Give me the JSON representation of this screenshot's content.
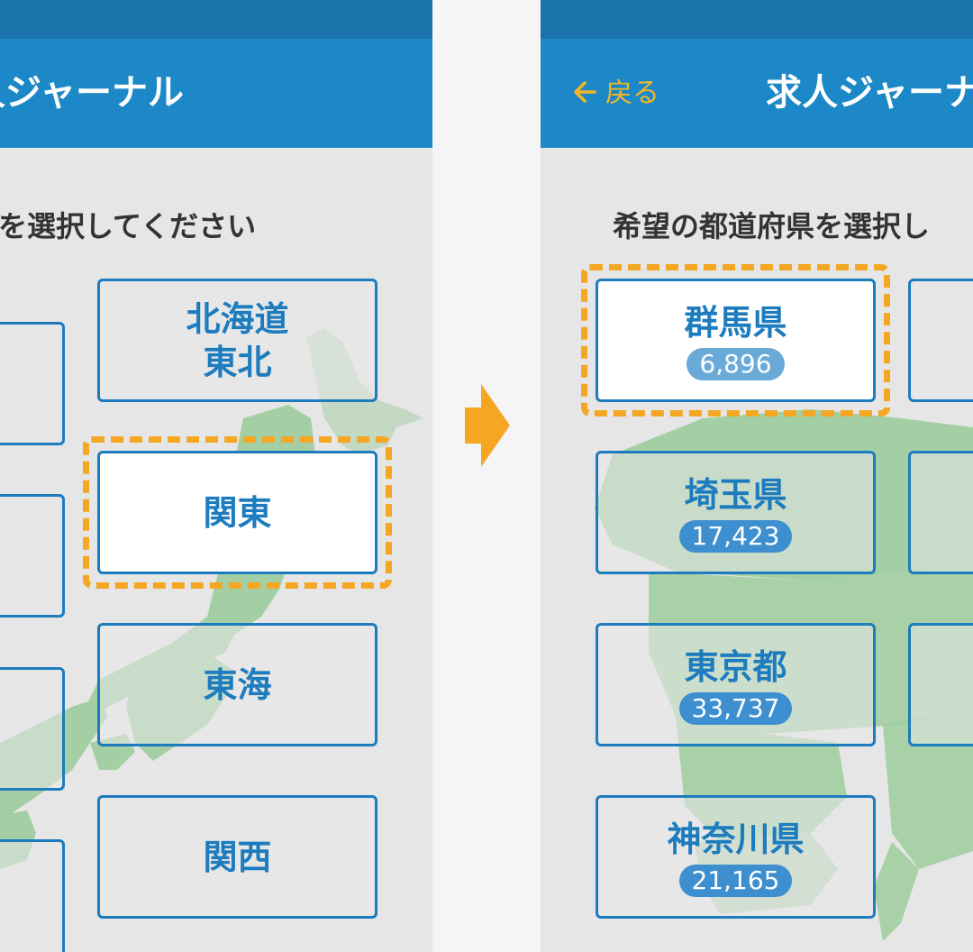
{
  "left_screen": {
    "app_title": "人ジャーナル",
    "prompt": "アを選択してください",
    "regions": [
      {
        "label_line1": "北海道",
        "label_line2": "東北"
      },
      {
        "label_line1": "関東",
        "label_line2": ""
      },
      {
        "label_line1": "東海",
        "label_line2": ""
      },
      {
        "label_line1": "関西",
        "label_line2": ""
      }
    ],
    "selected_region": "関東"
  },
  "right_screen": {
    "back_label": "戻る",
    "app_title": "求人ジャーナ",
    "prompt": "希望の都道府県を選択し",
    "prefectures": [
      {
        "name": "群馬県",
        "count": "6,896"
      },
      {
        "name": "埼玉県",
        "count": "17,423"
      },
      {
        "name": "東京都",
        "count": "33,737"
      },
      {
        "name": "神奈川県",
        "count": "21,165"
      }
    ],
    "selected_prefecture": "群馬県"
  },
  "colors": {
    "status_bar": "#1a74ab",
    "app_bar": "#1d88c7",
    "tile_border": "#1d7cbe",
    "highlight": "#f5a623",
    "back_link": "#f4b625",
    "map_fill": "#9ccc9c"
  },
  "icons": {
    "back": "arrow-left-icon",
    "transition": "arrow-right-icon"
  }
}
